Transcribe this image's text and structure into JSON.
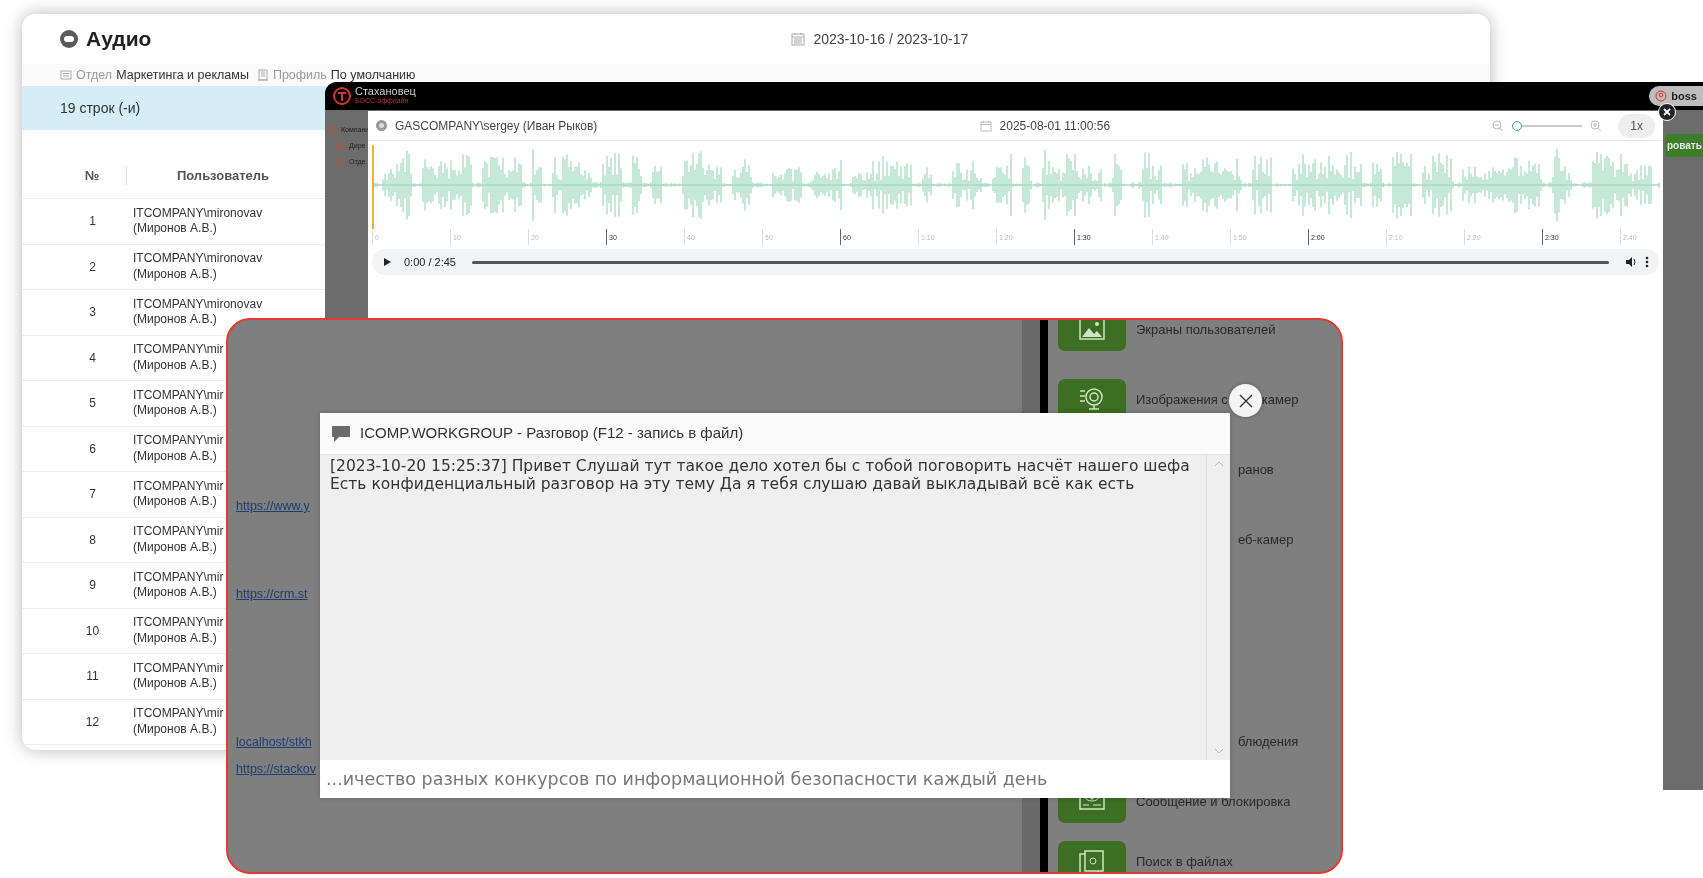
{
  "report_window": {
    "title": "Аудио",
    "date_range": "2023-10-16 / 2023-10-17",
    "filters": [
      {
        "label": "Отдел",
        "value": "Маркетинга и рекламы"
      },
      {
        "label": "Профиль",
        "value": "По умолчанию"
      }
    ],
    "row_count": "19 строк (-и)",
    "table": {
      "columns": [
        "№",
        "Пользователь"
      ],
      "rows": [
        {
          "num": "1",
          "user": "ITCOMPANY\\mironovav",
          "user_name": "(Миронов А.В.)"
        },
        {
          "num": "2",
          "user": "ITCOMPANY\\mironovav",
          "user_name": "(Миронов А.В.)"
        },
        {
          "num": "3",
          "user": "ITCOMPANY\\mironovav",
          "user_name": "(Миронов А.В.)"
        },
        {
          "num": "4",
          "user": "ITCOMPANY\\mir",
          "user_name": "(Миронов А.В.)"
        },
        {
          "num": "5",
          "user": "ITCOMPANY\\mir",
          "user_name": "(Миронов А.В.)"
        },
        {
          "num": "6",
          "user": "ITCOMPANY\\mir",
          "user_name": "(Миронов А.В.)"
        },
        {
          "num": "7",
          "user": "ITCOMPANY\\mir",
          "user_name": "(Миронов А.В.)"
        },
        {
          "num": "8",
          "user": "ITCOMPANY\\mir",
          "user_name": "(Миронов А.В.)"
        },
        {
          "num": "9",
          "user": "ITCOMPANY\\mir",
          "user_name": "(Миронов А.В.)"
        },
        {
          "num": "10",
          "user": "ITCOMPANY\\mir",
          "user_name": "(Миронов А.В.)"
        },
        {
          "num": "11",
          "user": "ITCOMPANY\\mir",
          "user_name": "(Миронов А.В.)"
        },
        {
          "num": "12",
          "user": "ITCOMPANY\\mir",
          "user_name": "(Миронов А.В.)"
        }
      ]
    }
  },
  "app_window": {
    "brand": "Стахановец",
    "brand_subtitle": "БОСС-оффлайн",
    "user": "boss",
    "tree": [
      {
        "label": "Компани",
        "children": [
          {
            "label": "Дире"
          },
          {
            "label": "Отде"
          }
        ]
      }
    ],
    "side_button": "ровать",
    "player": {
      "user": "GASCOMPANY\\sergey (Иван Рыков)",
      "datetime": "2025-08-01 11:00:56",
      "zoom": {
        "level": 0
      },
      "speed": "1x",
      "timeline": [
        {
          "label": "0",
          "major": false
        },
        {
          "label": "10",
          "major": false
        },
        {
          "label": "20",
          "major": false
        },
        {
          "label": "30",
          "major": true
        },
        {
          "label": "40",
          "major": false
        },
        {
          "label": "50",
          "major": false
        },
        {
          "label": "60",
          "major": true
        },
        {
          "label": "1:10",
          "major": false
        },
        {
          "label": "1:20",
          "major": false
        },
        {
          "label": "1:30",
          "major": true
        },
        {
          "label": "1:40",
          "major": false
        },
        {
          "label": "1:50",
          "major": false
        },
        {
          "label": "2:00",
          "major": true
        },
        {
          "label": "2:10",
          "major": false
        },
        {
          "label": "2:20",
          "major": false
        },
        {
          "label": "2:30",
          "major": true
        },
        {
          "label": "2:40",
          "major": false
        }
      ],
      "time": "0:00 / 2:45"
    }
  },
  "overlay_panel": {
    "links": [
      "https://www.y",
      "https://crm.st",
      "localhost/stkh",
      "https://stackov"
    ],
    "menu_top": [
      {
        "kind": "full",
        "label": "Экраны пользователей"
      },
      {
        "kind": "full",
        "label": "Изображения с",
        "label_tail": "камер"
      },
      {
        "kind": "covered",
        "label": "ранов"
      },
      {
        "kind": "covered",
        "label": "еб-камер"
      }
    ],
    "menu_bottom": [
      {
        "kind": "covered",
        "label": "блюдения"
      },
      {
        "kind": "full",
        "label": "Сообщение и блокировка"
      },
      {
        "kind": "full",
        "label": "Поиск в файлах"
      }
    ]
  },
  "dialog": {
    "title": "ICOMP.WORKGROUP - Разговор (F12 - запись в файл)",
    "transcript": "[2023-10-20 15:25:37] Привет Слушай тут такое дело хотел бы с тобой поговорить насчёт нашего шефа Есть конфиденциальный разговор на эту тему Да я тебя слушаю давай выкладывай всё как есть",
    "input_value": "...ичество разных конкурсов по информационной безопасности каждый день"
  }
}
